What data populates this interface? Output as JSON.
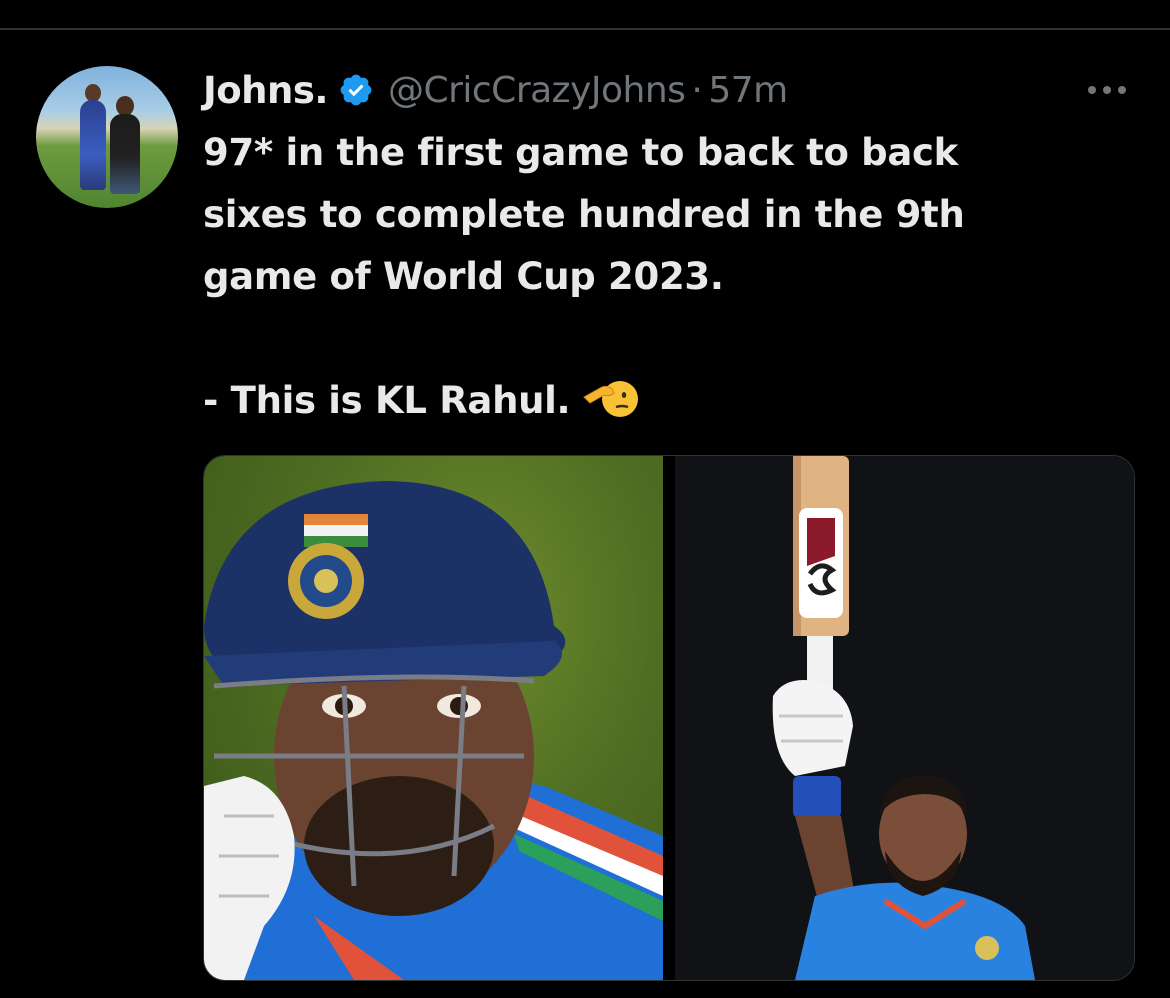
{
  "tweet": {
    "author_name": "Johns.",
    "handle": "@CricCrazyJohns",
    "separator": "·",
    "time": "57m",
    "text_lines": [
      "97* in the first game to back to back",
      "sixes to complete hundred in the 9th",
      "game of World Cup 2023.",
      "",
      "- This is KL Rahul."
    ],
    "emoji": "saluting-face-emoji",
    "verified_icon": "verified-badge-icon",
    "more_icon": "more-options-icon"
  },
  "colors": {
    "background": "#000000",
    "primary_text": "#e7e9ea",
    "secondary_text": "#71767b",
    "verified_blue": "#1d9bf0",
    "divider": "#2f3336"
  },
  "media": {
    "images": [
      {
        "name": "helmet-closeup-photo"
      },
      {
        "name": "bat-raised-celebration-photo"
      }
    ]
  }
}
